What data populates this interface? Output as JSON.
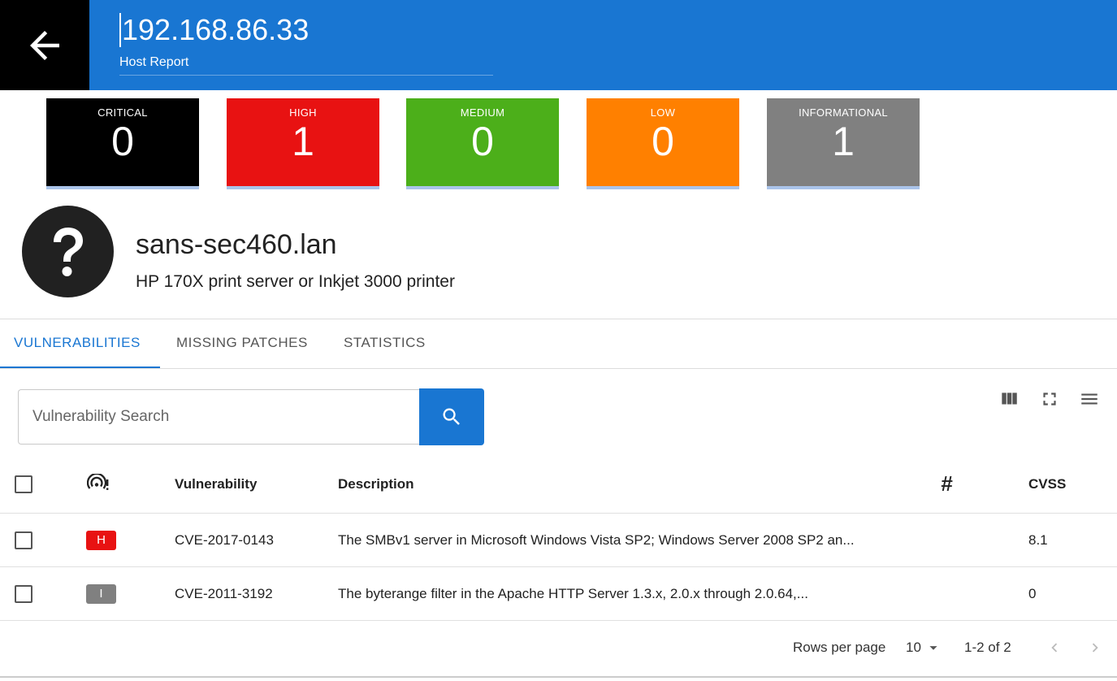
{
  "header": {
    "ip": "192.168.86.33",
    "subtitle": "Host Report"
  },
  "severity_cards": [
    {
      "label": "CRITICAL",
      "count": "0",
      "color": "#000000"
    },
    {
      "label": "HIGH",
      "count": "1",
      "color": "#e81212"
    },
    {
      "label": "MEDIUM",
      "count": "0",
      "color": "#4caf1a"
    },
    {
      "label": "LOW",
      "count": "0",
      "color": "#ff8000"
    },
    {
      "label": "INFORMATIONAL",
      "count": "1",
      "color": "#808080"
    }
  ],
  "host": {
    "avatar_icon": "question-mark-icon",
    "hostname": "sans-sec460.lan",
    "os": "HP 170X print server or Inkjet 3000 printer"
  },
  "tabs": [
    {
      "label": "VULNERABILITIES",
      "active": true
    },
    {
      "label": "MISSING PATCHES",
      "active": false
    },
    {
      "label": "STATISTICS",
      "active": false
    }
  ],
  "search": {
    "placeholder": "Vulnerability Search",
    "value": ""
  },
  "toolbar_icons": [
    "view-columns-icon",
    "fullscreen-icon",
    "menu-icon"
  ],
  "table": {
    "columns": {
      "severity_icon": "wifi-alert-icon",
      "vulnerability": "Vulnerability",
      "description": "Description",
      "count": "#",
      "cvss": "CVSS"
    },
    "rows": [
      {
        "severity": "H",
        "severity_color": "#e81212",
        "vulnerability": "CVE-2017-0143",
        "description": "The SMBv1 server in Microsoft Windows Vista SP2; Windows Server 2008 SP2 an...",
        "count": "",
        "cvss": "8.1"
      },
      {
        "severity": "I",
        "severity_color": "#808080",
        "vulnerability": "CVE-2011-3192",
        "description": "The byterange filter in the Apache HTTP Server 1.3.x, 2.0.x through 2.0.64,...",
        "count": "",
        "cvss": "0"
      }
    ]
  },
  "pagination": {
    "rows_per_page_label": "Rows per page",
    "rows_per_page_value": "10",
    "range": "1-2 of 2"
  }
}
